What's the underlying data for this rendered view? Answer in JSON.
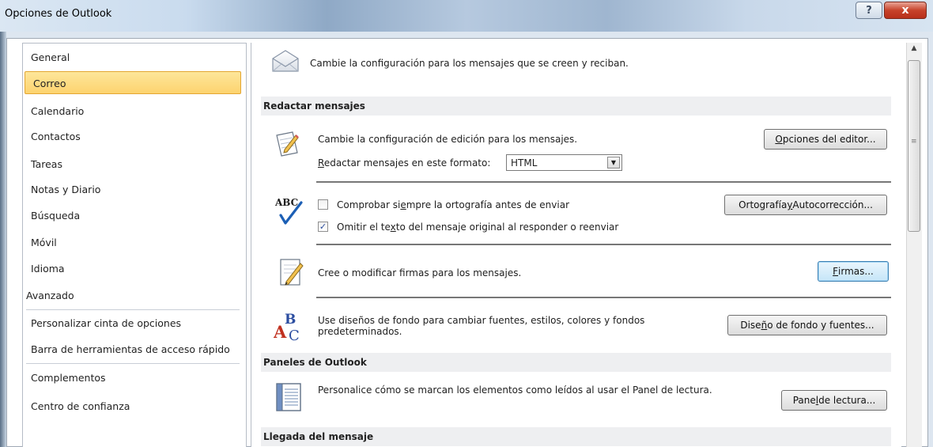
{
  "window": {
    "title": "Opciones de Outlook",
    "help_glyph": "?",
    "close_glyph": "x"
  },
  "sidebar": {
    "items": [
      {
        "label": "General"
      },
      {
        "label": "Correo",
        "selected": true
      },
      {
        "label": "Calendario"
      },
      {
        "label": "Contactos"
      },
      {
        "label": "Tareas"
      },
      {
        "label": "Notas y Diario"
      },
      {
        "label": "Búsqueda"
      },
      {
        "label": "Móvil"
      },
      {
        "label": "Idioma"
      },
      {
        "label": "Avanzado"
      },
      {
        "label": "Personalizar cinta de opciones"
      },
      {
        "label": "Barra de herramientas de acceso rápido"
      },
      {
        "label": "Complementos"
      },
      {
        "label": "Centro de confianza"
      }
    ]
  },
  "main": {
    "header": "Cambie la configuración para los mensajes que se creen y reciban.",
    "compose": {
      "section_title": "Redactar mensajes",
      "editing_text": "Cambie la configuración de edición para los mensajes.",
      "editor_button": {
        "pre": "",
        "key": "O",
        "post": "pciones del editor..."
      },
      "format_label": {
        "pre": "",
        "key": "R",
        "post": "edactar mensajes en este formato:"
      },
      "format_value": "HTML",
      "spell_check": {
        "pre": "Comprobar siempre la ortografía antes de enviar",
        "checked": false
      },
      "spell_button": {
        "pre": "Ortografía ",
        "key": "y",
        "post": " Autocorrección..."
      },
      "omit_text": {
        "pre": "Omitir el te",
        "key": "x",
        "post": "to del mensaje original al responder o reenviar",
        "checked": true
      },
      "signatures_text": "Cree o modificar firmas para los mensajes.",
      "signatures_button": {
        "pre": "",
        "key": "F",
        "post": "irmas..."
      },
      "stationery_text_1": "Use diseños de fondo para cambiar fuentes, estilos, colores y fondos",
      "stationery_text_2": "predeterminados.",
      "stationery_button": {
        "pre": "Dise",
        "key": "ñ",
        "post": "o de fondo y fuentes..."
      }
    },
    "panes": {
      "section_title": "Paneles de Outlook",
      "reading_text": "Personalice cómo se marcan los elementos como leídos al usar el Panel de lectura.",
      "reading_button": {
        "pre": "Pane",
        "key": "l",
        "post": " de lectura..."
      }
    },
    "arrival": {
      "section_title": "Llegada del mensaje"
    },
    "spell_check_label": {
      "pre": "Comprobar si",
      "key": "e",
      "post": "mpre la ortografía antes de enviar"
    }
  },
  "colors": {
    "selection_fill": "#fdd36f",
    "selection_border": "#e3a631",
    "default_button": "#c5e5f8"
  },
  "icons": {
    "envelope": "envelope-icon",
    "edit": "edit-document-icon",
    "spelling": "abc-check-icon",
    "signature": "signature-pen-icon",
    "stationery": "stationery-letters-icon",
    "reading_pane": "reading-pane-icon"
  }
}
